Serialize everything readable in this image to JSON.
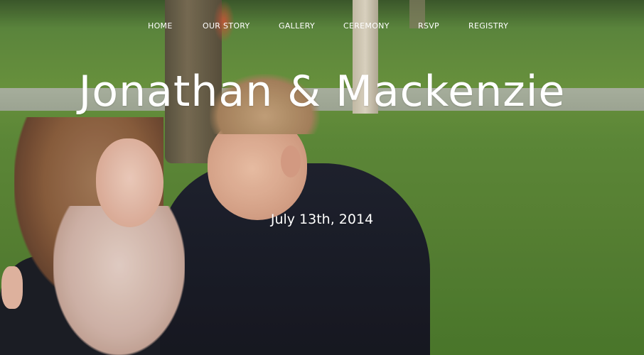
{
  "nav": {
    "items": [
      {
        "label": "HOME"
      },
      {
        "label": "OUR STORY"
      },
      {
        "label": "GALLERY"
      },
      {
        "label": "CEREMONY"
      },
      {
        "label": "RSVP"
      },
      {
        "label": "REGISTRY"
      }
    ]
  },
  "hero": {
    "title": "Jonathan & Mackenzie",
    "date": "July 13th, 2014"
  },
  "colors": {
    "text": "#ffffff",
    "grass": "#5f8c3a",
    "shirt": "#1d1f26"
  }
}
